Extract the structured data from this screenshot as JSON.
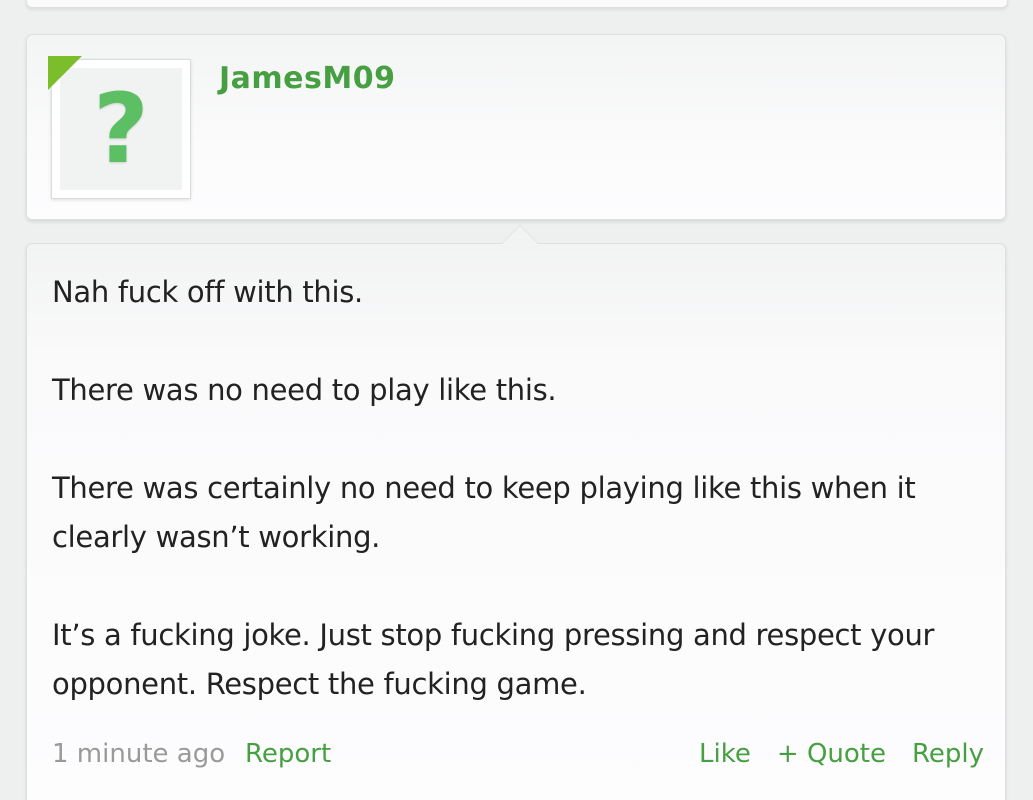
{
  "user": {
    "username": "JamesM09",
    "avatar_glyph": "?",
    "avatar_color": "#5cbf63",
    "corner_flag_color": "#7bbd2a"
  },
  "message": {
    "paragraphs": [
      "Nah fuck off with this.",
      "There was no need to play like this.",
      "There was certainly no need to keep playing like this when it clearly wasn’t working.",
      "It’s a fucking joke. Just stop fucking pressing and respect your opponent. Respect the fucking game."
    ],
    "timestamp": "1 minute ago",
    "report_label": "Report",
    "actions": {
      "like_label": "Like",
      "quote_label": "+ Quote",
      "reply_label": "Reply"
    }
  },
  "colors": {
    "accent": "#46a041",
    "muted_text": "#9a9a9a",
    "body_text": "#222222"
  }
}
